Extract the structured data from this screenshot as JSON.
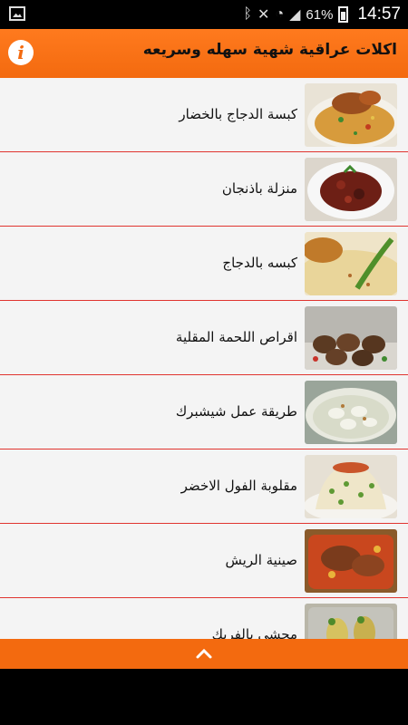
{
  "status": {
    "battery": "61%",
    "time": "14:57",
    "icons": [
      "gallery-icon",
      "bluetooth-icon",
      "mute-icon",
      "wifi-icon",
      "signal-icon",
      "battery-icon"
    ]
  },
  "app": {
    "title": "اكلات عراقية شهية سهله وسريعه",
    "info_glyph": "i"
  },
  "items": [
    {
      "label": "كبسة الدجاج بالخضار"
    },
    {
      "label": "منزلة باذنجان"
    },
    {
      "label": "كبسه بالدجاج"
    },
    {
      "label": "اقراص اللحمة المقلية"
    },
    {
      "label": "طريقة عمل شيشبرك"
    },
    {
      "label": "مقلوبة الفول الاخضر"
    },
    {
      "label": "صينية الريش"
    },
    {
      "label": "محشي بالفريك"
    }
  ],
  "colors": {
    "accent": "#f36a0f",
    "divider": "#e0342f",
    "list_bg": "#f4f4f4"
  }
}
